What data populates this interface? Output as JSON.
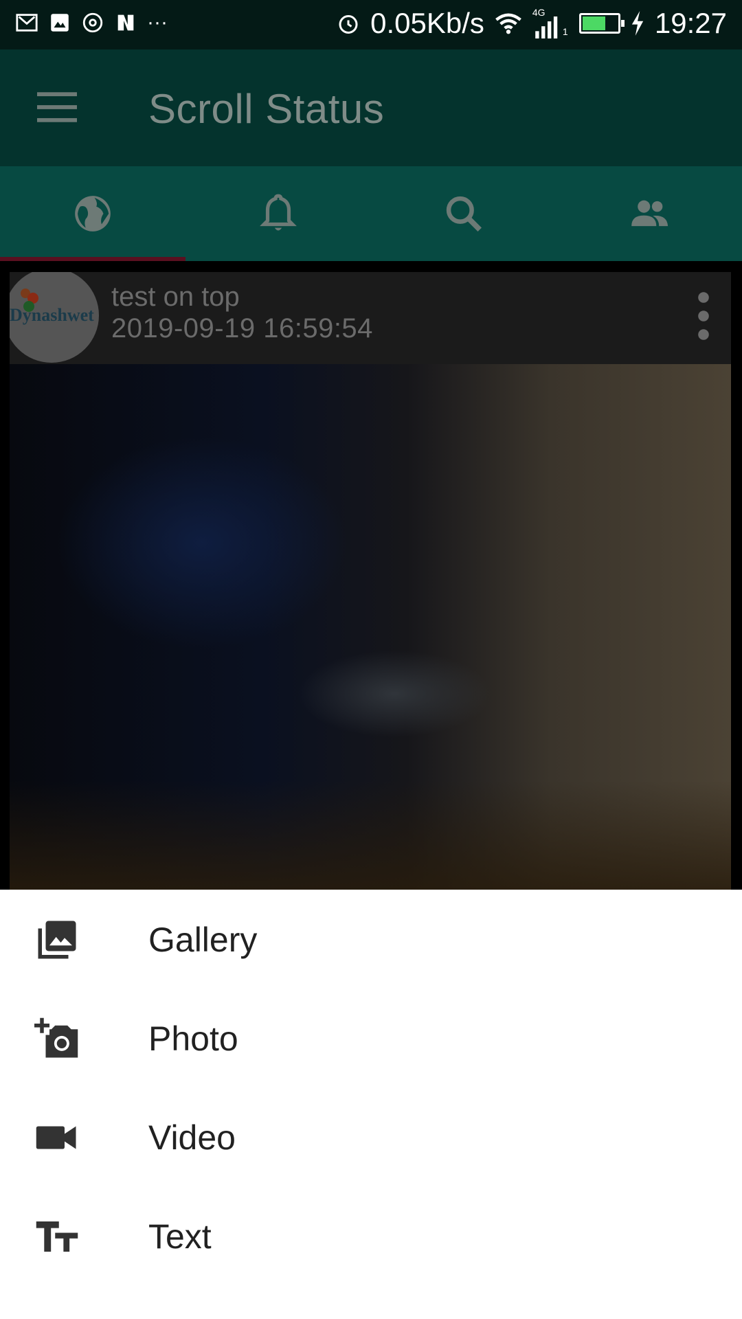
{
  "status_bar": {
    "network_speed": "0.05Kb/s",
    "network_type": "4G",
    "sim_slot": "1",
    "time": "19:27",
    "battery_level": 0.65,
    "overflow_dots": "···",
    "icons": [
      "gmail-icon",
      "image-icon",
      "music-icon",
      "nfc-icon",
      "alarm-icon",
      "wifi-icon",
      "signal-icon",
      "battery-icon",
      "charging-icon"
    ]
  },
  "app_bar": {
    "title": "Scroll Status",
    "menu_icon": "hamburger-menu-icon"
  },
  "tabs": [
    {
      "icon": "globe-icon",
      "selected": true
    },
    {
      "icon": "bell-icon",
      "selected": false
    },
    {
      "icon": "search-icon",
      "selected": false
    },
    {
      "icon": "people-icon",
      "selected": false
    }
  ],
  "post": {
    "author": "test on top",
    "timestamp": "2019-09-19 16:59:54",
    "avatar_text": "Dynashwet",
    "menu_icon": "more-vert-icon"
  },
  "bottom_sheet": {
    "items": [
      {
        "label": "Gallery",
        "icon": "photo-library-icon"
      },
      {
        "label": "Photo",
        "icon": "add-a-photo-icon"
      },
      {
        "label": "Video",
        "icon": "videocam-icon"
      },
      {
        "label": "Text",
        "icon": "text-fields-icon"
      }
    ]
  },
  "colors": {
    "app_bar": "#04332d",
    "tab_bar": "#074a42",
    "tab_indicator": "#5a1020",
    "sheet_background": "#ffffff",
    "sheet_text": "#212121"
  }
}
